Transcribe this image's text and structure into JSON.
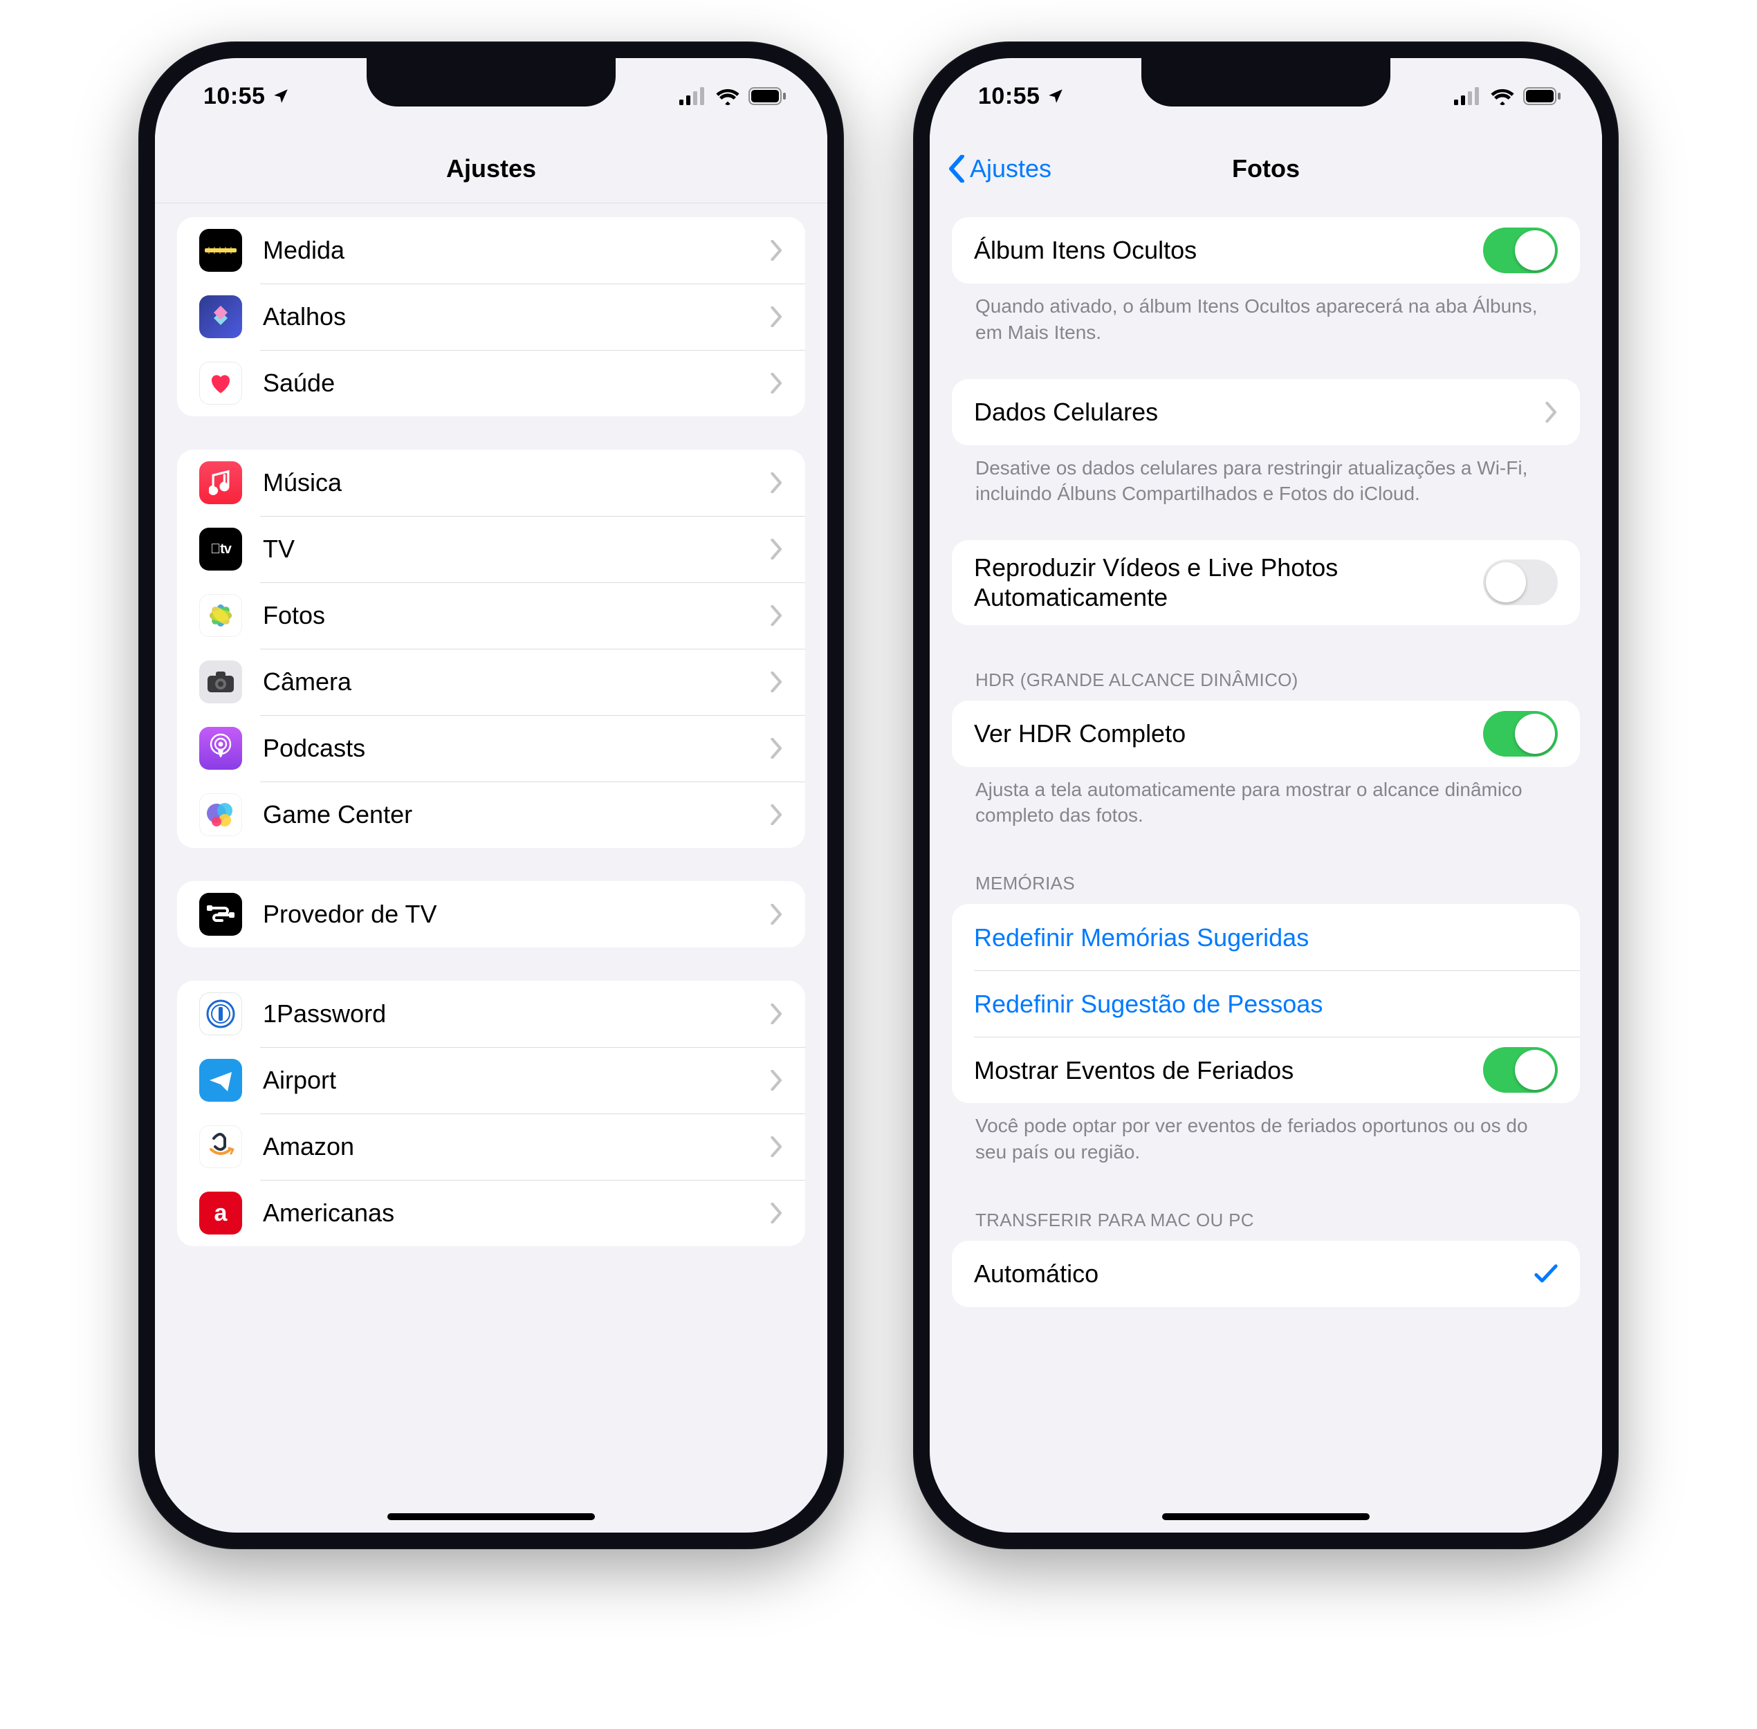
{
  "status": {
    "time": "10:55"
  },
  "left": {
    "title": "Ajustes",
    "groups": [
      {
        "items": [
          {
            "key": "measure",
            "label": "Medida"
          },
          {
            "key": "shortcuts",
            "label": "Atalhos"
          },
          {
            "key": "health",
            "label": "Saúde"
          }
        ]
      },
      {
        "items": [
          {
            "key": "music",
            "label": "Música"
          },
          {
            "key": "tv",
            "label": "TV"
          },
          {
            "key": "photos",
            "label": "Fotos"
          },
          {
            "key": "camera",
            "label": "Câmera"
          },
          {
            "key": "podcasts",
            "label": "Podcasts"
          },
          {
            "key": "gamecenter",
            "label": "Game Center"
          }
        ]
      },
      {
        "items": [
          {
            "key": "tvprovider",
            "label": "Provedor de TV"
          }
        ]
      },
      {
        "items": [
          {
            "key": "onepassword",
            "label": "1Password"
          },
          {
            "key": "airport",
            "label": "Airport"
          },
          {
            "key": "amazon",
            "label": "Amazon"
          },
          {
            "key": "americanas",
            "label": "Americanas"
          }
        ]
      }
    ]
  },
  "right": {
    "back": "Ajustes",
    "title": "Fotos",
    "hidden_album_label": "Álbum Itens Ocultos",
    "hidden_album_on": true,
    "hidden_album_footer": "Quando ativado, o álbum Itens Ocultos aparecerá na aba Álbuns, em Mais Itens.",
    "cellular_label": "Dados Celulares",
    "cellular_footer": "Desative os dados celulares para restringir atualizações a Wi-Fi, incluindo Álbuns Compartilhados e Fotos do iCloud.",
    "autoplay_label": "Reproduzir Vídeos e Live Photos Automaticamente",
    "autoplay_on": false,
    "hdr_header": "HDR (GRANDE ALCANCE DINÂMICO)",
    "hdr_label": "Ver HDR Completo",
    "hdr_on": true,
    "hdr_footer": "Ajusta a tela automaticamente para mostrar o alcance dinâmico completo das fotos.",
    "memories_header": "MEMÓRIAS",
    "memories_reset": "Redefinir Memórias Sugeridas",
    "memories_people": "Redefinir Sugestão de Pessoas",
    "memories_holiday_label": "Mostrar Eventos de Feriados",
    "memories_holiday_on": true,
    "memories_footer": "Você pode optar por ver eventos de feriados oportunos ou os do seu país ou região.",
    "transfer_header": "TRANSFERIR PARA MAC OU PC",
    "transfer_auto": "Automático"
  }
}
